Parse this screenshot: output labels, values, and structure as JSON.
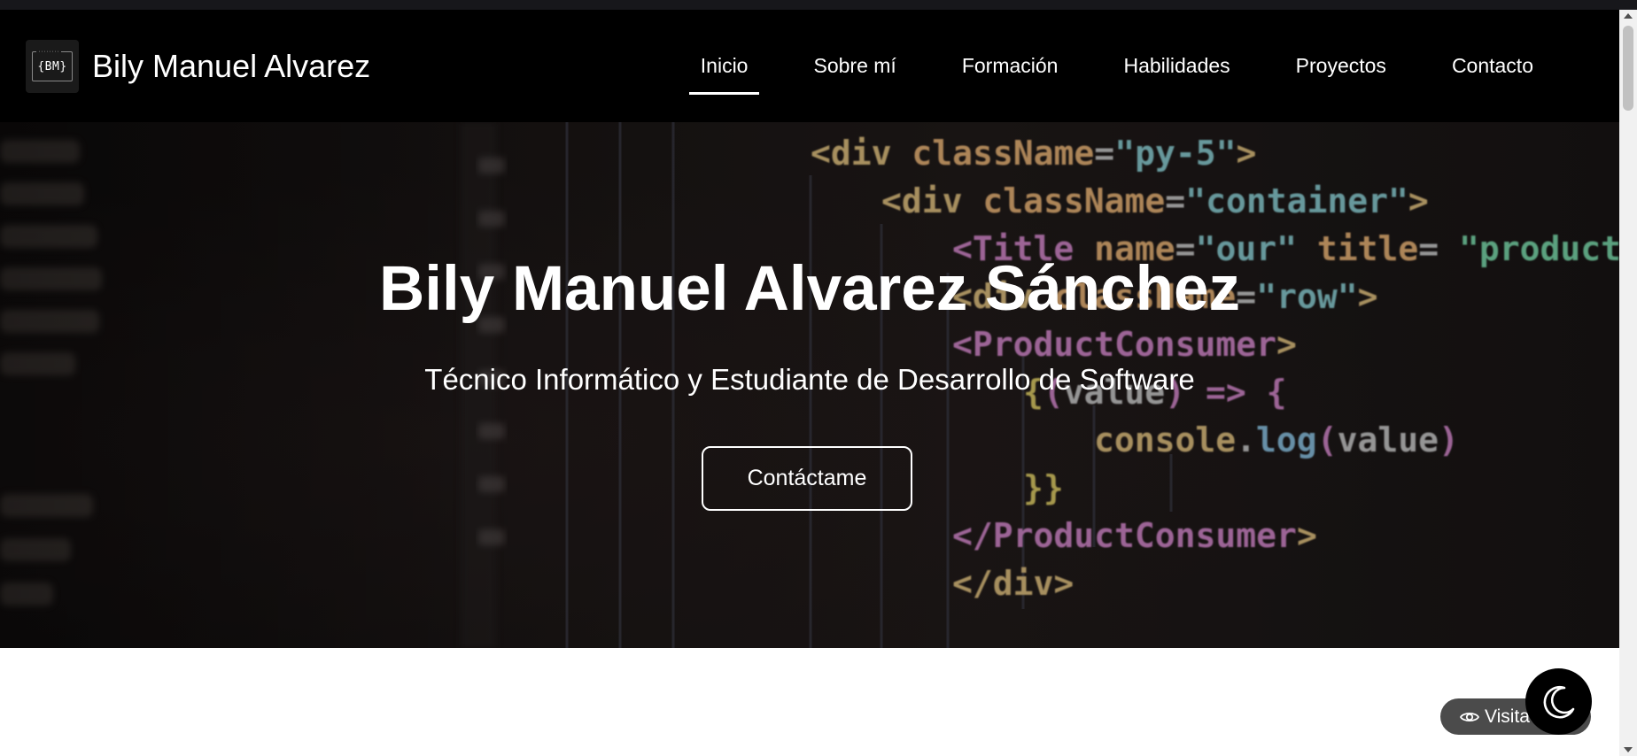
{
  "brand": {
    "logo_text": "{BM}",
    "logo_dots": "········",
    "name": "Bily Manuel Alvarez"
  },
  "nav": {
    "items": [
      {
        "label": "Inicio",
        "active": true
      },
      {
        "label": "Sobre mí",
        "active": false
      },
      {
        "label": "Formación",
        "active": false
      },
      {
        "label": "Habilidades",
        "active": false
      },
      {
        "label": "Proyectos",
        "active": false
      },
      {
        "label": "Contacto",
        "active": false
      }
    ]
  },
  "hero": {
    "title": "Bily Manuel Alvarez Sánchez",
    "subtitle": "Técnico Informático y Estudiante de Desarrollo de Software",
    "button_label": "Contáctame",
    "code_lines": [
      {
        "indent": 0,
        "parts": [
          [
            "<div ",
            "#e8c784"
          ],
          [
            "className",
            "#f0b97a"
          ],
          [
            "=",
            "#cfcfcf"
          ],
          [
            "\"py-5\"",
            "#8fd3d8"
          ],
          [
            ">",
            "#e8c784"
          ]
        ]
      },
      {
        "indent": 1,
        "parts": [
          [
            "<div ",
            "#e8c784"
          ],
          [
            "className",
            "#f0b97a"
          ],
          [
            "=",
            "#cfcfcf"
          ],
          [
            "\"container\"",
            "#8fd3d8"
          ],
          [
            ">",
            "#e8c784"
          ]
        ]
      },
      {
        "indent": 2,
        "parts": [
          [
            "<Title ",
            "#d98bd0"
          ],
          [
            "name",
            "#f0b97a"
          ],
          [
            "=",
            "#cfcfcf"
          ],
          [
            "\"our\" ",
            "#8fd3d8"
          ],
          [
            "title",
            "#f0b97a"
          ],
          [
            "= ",
            "#cfcfcf"
          ],
          [
            "\"product",
            "#7fe0b0"
          ]
        ]
      },
      {
        "indent": 2,
        "parts": [
          [
            "<div ",
            "#e8c784"
          ],
          [
            "className",
            "#f0b97a"
          ],
          [
            "=",
            "#cfcfcf"
          ],
          [
            "\"row\"",
            "#8fd3d8"
          ],
          [
            ">",
            "#e8c784"
          ]
        ]
      },
      {
        "indent": 2,
        "parts": [
          [
            "<ProductConsumer",
            "#d98bd0"
          ],
          [
            ">",
            "#e8c784"
          ]
        ]
      },
      {
        "indent": 3,
        "parts": [
          [
            "{",
            "#e6d36a"
          ],
          [
            "(",
            "#d98bd0"
          ],
          [
            "value",
            "#cfcfcf"
          ],
          [
            ")",
            "#d98bd0"
          ],
          [
            " => ",
            "#d98bd0"
          ],
          [
            "{",
            "#d98bd0"
          ]
        ]
      },
      {
        "indent": 4,
        "parts": [
          [
            "console",
            "#e8c784"
          ],
          [
            ".",
            "#cfcfcf"
          ],
          [
            "log",
            "#8fc7e8"
          ],
          [
            "(",
            "#d98bd0"
          ],
          [
            "value",
            "#cfcfcf"
          ],
          [
            ")",
            "#d98bd0"
          ]
        ]
      },
      {
        "indent": 3,
        "parts": [
          [
            "}}",
            "#e6d36a"
          ]
        ]
      },
      {
        "indent": 2,
        "parts": [
          [
            "</ProductConsumer",
            "#d98bd0"
          ],
          [
            ">",
            "#e8c784"
          ]
        ]
      },
      {
        "indent": 2,
        "parts": [
          [
            "</div>",
            "#e8c784"
          ]
        ]
      }
    ]
  },
  "visit_badge": {
    "label": "Visita"
  },
  "colors": {
    "navbar_bg": "#000000",
    "badge_bg": "#4b4b4b",
    "hero_text": "#ffffff"
  },
  "icons": {
    "theme_toggle": "moon-icon",
    "visit": "eye-icon"
  }
}
